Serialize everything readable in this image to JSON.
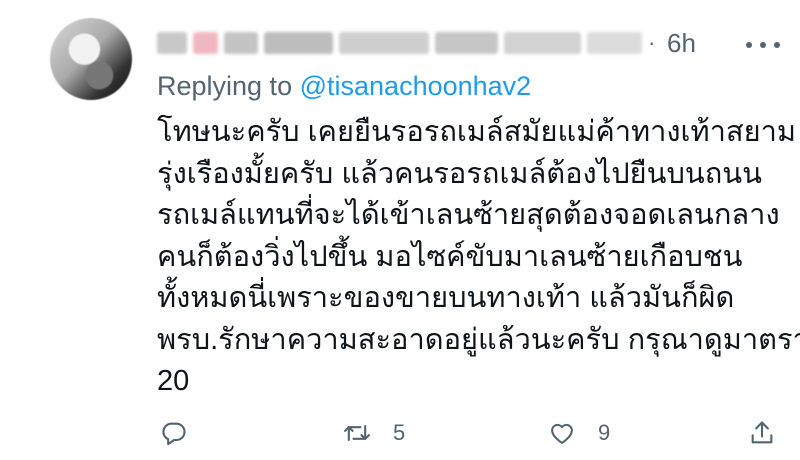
{
  "header": {
    "separator": "·",
    "time": "6h"
  },
  "reply_context": {
    "prefix": "Replying to",
    "handle": "@tisanachoonhav2"
  },
  "body_lines": [
    "โทษนะครับ เคยยืนรอรถเมล์สมัยแม่ค้าทางเท้าสยาม",
    "รุ่งเรืองมั้ยครับ แล้วคนรอรถเมล์ต้องไปยืนบนถนน",
    "รถเมล์แทนที่จะได้เข้าเลนซ้ายสุดต้องจอดเลนกลาง",
    "คนก็ต้องวิ่งไปขึ้น มอไซค์ขับมาเลนซ้ายเกือบชน",
    "ทั้งหมดนี่เพราะของขายบนทางเท้า แล้วมันก็ผิด",
    "พรบ.รักษาความสะอาดอยู่แล้วนะครับ กรุณาดูมาตรา",
    "20"
  ],
  "actions": {
    "reply": {
      "icon": "reply-icon",
      "count": ""
    },
    "retweet": {
      "icon": "retweet-icon",
      "count": "5"
    },
    "like": {
      "icon": "heart-icon",
      "count": "9"
    },
    "share": {
      "icon": "share-icon",
      "count": ""
    }
  },
  "colors": {
    "text": "#0f1419",
    "secondary": "#536471",
    "accent": "#1d9bf0"
  }
}
